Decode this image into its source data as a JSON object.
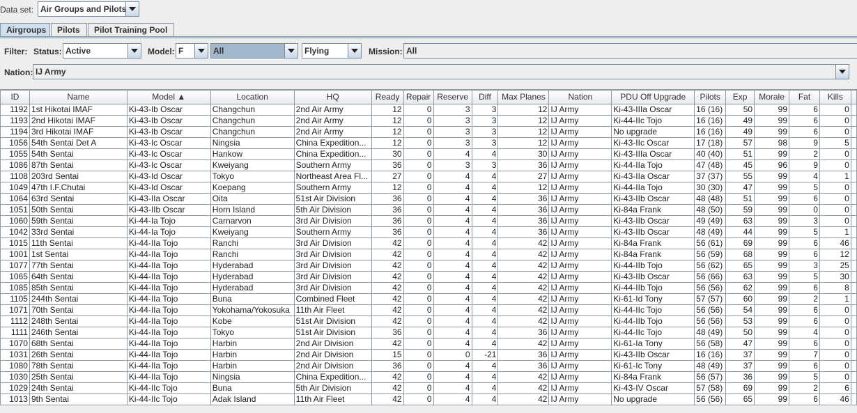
{
  "dataset": {
    "label": "Data set:",
    "value": "Air Groups and Pilots"
  },
  "tabs": [
    "Airgroups",
    "Pilots",
    "Pilot Training Pool"
  ],
  "filter": {
    "label": "Filter:",
    "status_label": "Status:",
    "status": "Active",
    "model_label": "Model:",
    "model": "F",
    "model_type": "All",
    "flying": "Flying",
    "mission_label": "Mission:",
    "mission": "All",
    "nation_label": "Nation:",
    "nation": "IJ Army"
  },
  "columns": [
    {
      "label": "ID",
      "n": 1
    },
    {
      "label": "Name",
      "n": 0
    },
    {
      "label": "Model ▲",
      "n": 0
    },
    {
      "label": "Location",
      "n": 0
    },
    {
      "label": "HQ",
      "n": 0
    },
    {
      "label": "Ready",
      "n": 1
    },
    {
      "label": "Repair",
      "n": 1
    },
    {
      "label": "Reserve",
      "n": 1
    },
    {
      "label": "Diff",
      "n": 1
    },
    {
      "label": "Max Planes",
      "n": 1
    },
    {
      "label": "Nation",
      "n": 0
    },
    {
      "label": "PDU Off Upgrade",
      "n": 0
    },
    {
      "label": "Pilots",
      "n": 0
    },
    {
      "label": "Exp",
      "n": 1
    },
    {
      "label": "Morale",
      "n": 1
    },
    {
      "label": "Fat",
      "n": 1
    },
    {
      "label": "Kills",
      "n": 1
    },
    {
      "label": "",
      "n": 0
    }
  ],
  "rows": [
    [
      "1192",
      "1st Hikotai IMAF",
      "Ki-43-Ib Oscar",
      "Changchun",
      "2nd Air Army",
      "12",
      "0",
      "3",
      "3",
      "12",
      "IJ Army",
      "Ki-43-IIIa Oscar",
      "16 (16)",
      "50",
      "99",
      "6",
      "0",
      ""
    ],
    [
      "1193",
      "2nd Hikotai IMAF",
      "Ki-43-Ib Oscar",
      "Changchun",
      "2nd Air Army",
      "12",
      "0",
      "3",
      "3",
      "12",
      "IJ Army",
      "Ki-44-IIc Tojo",
      "16 (16)",
      "49",
      "99",
      "6",
      "0",
      ""
    ],
    [
      "1194",
      "3rd Hikotai IMAF",
      "Ki-43-Ib Oscar",
      "Changchun",
      "2nd Air Army",
      "12",
      "0",
      "3",
      "3",
      "12",
      "IJ Army",
      "No upgrade",
      "16 (16)",
      "49",
      "99",
      "6",
      "0",
      ""
    ],
    [
      "1056",
      "54th Sentai Det A",
      "Ki-43-Ic Oscar",
      "Ningsia",
      "China Expedition...",
      "12",
      "0",
      "3",
      "3",
      "12",
      "IJ Army",
      "Ki-43-IIc Oscar",
      "17 (18)",
      "57",
      "98",
      "9",
      "5",
      ""
    ],
    [
      "1055",
      "54th Sentai",
      "Ki-43-Ic Oscar",
      "Hankow",
      "China Expedition...",
      "30",
      "0",
      "4",
      "4",
      "30",
      "IJ Army",
      "Ki-43-IIIa Oscar",
      "40 (40)",
      "51",
      "99",
      "2",
      "0",
      ""
    ],
    [
      "1086",
      "87th Sentai",
      "Ki-43-Ic Oscar",
      "Kweiyang",
      "Southern Army",
      "36",
      "0",
      "3",
      "3",
      "36",
      "IJ Army",
      "Ki-44-IIa Tojo",
      "47 (48)",
      "45",
      "96",
      "9",
      "0",
      ""
    ],
    [
      "1108",
      "203rd Sentai",
      "Ki-43-Id Oscar",
      "Tokyo",
      "Northeast Area Fl...",
      "27",
      "0",
      "4",
      "4",
      "27",
      "IJ Army",
      "Ki-43-IIa Oscar",
      "37 (37)",
      "55",
      "99",
      "4",
      "1",
      ""
    ],
    [
      "1049",
      "47th I.F.Chutai",
      "Ki-43-Id Oscar",
      "Koepang",
      "Southern Army",
      "12",
      "0",
      "4",
      "4",
      "12",
      "IJ Army",
      "Ki-44-IIa Tojo",
      "30 (30)",
      "47",
      "99",
      "5",
      "0",
      ""
    ],
    [
      "1064",
      "63rd Sentai",
      "Ki-43-IIa Oscar",
      "Oita",
      "51st Air Division",
      "36",
      "0",
      "4",
      "4",
      "36",
      "IJ Army",
      "Ki-43-IIb Oscar",
      "48 (48)",
      "51",
      "99",
      "6",
      "0",
      ""
    ],
    [
      "1051",
      "50th Sentai",
      "Ki-43-IIb Oscar",
      "Horn Island",
      "5th Air Division",
      "36",
      "0",
      "4",
      "4",
      "36",
      "IJ Army",
      "Ki-84a Frank",
      "48 (50)",
      "59",
      "99",
      "0",
      "0",
      ""
    ],
    [
      "1060",
      "59th Sentai",
      "Ki-44-Ia Tojo",
      "Carnarvon",
      "3rd Air Division",
      "36",
      "0",
      "4",
      "4",
      "36",
      "IJ Army",
      "Ki-43-IIb Oscar",
      "49 (49)",
      "63",
      "99",
      "3",
      "0",
      ""
    ],
    [
      "1042",
      "33rd Sentai",
      "Ki-44-Ia Tojo",
      "Kweiyang",
      "Southern Army",
      "36",
      "0",
      "4",
      "4",
      "36",
      "IJ Army",
      "Ki-43-IIb Oscar",
      "48 (49)",
      "44",
      "99",
      "5",
      "1",
      ""
    ],
    [
      "1015",
      "11th Sentai",
      "Ki-44-IIa Tojo",
      "Ranchi",
      "3rd Air Division",
      "42",
      "0",
      "4",
      "4",
      "42",
      "IJ Army",
      "Ki-84a Frank",
      "56 (61)",
      "69",
      "99",
      "6",
      "46",
      ""
    ],
    [
      "1001",
      "1st Sentai",
      "Ki-44-IIa Tojo",
      "Ranchi",
      "3rd Air Division",
      "42",
      "0",
      "4",
      "4",
      "42",
      "IJ Army",
      "Ki-84a Frank",
      "56 (59)",
      "68",
      "99",
      "6",
      "12",
      ""
    ],
    [
      "1077",
      "77th Sentai",
      "Ki-44-IIa Tojo",
      "Hyderabad",
      "3rd Air Division",
      "42",
      "0",
      "4",
      "4",
      "42",
      "IJ Army",
      "Ki-44-IIb Tojo",
      "56 (62)",
      "65",
      "99",
      "3",
      "25",
      ""
    ],
    [
      "1065",
      "64th Sentai",
      "Ki-44-IIa Tojo",
      "Hyderabad",
      "3rd Air Division",
      "42",
      "0",
      "4",
      "4",
      "42",
      "IJ Army",
      "Ki-43-IIb Oscar",
      "56 (66)",
      "63",
      "99",
      "5",
      "30",
      ""
    ],
    [
      "1085",
      "85th Sentai",
      "Ki-44-IIa Tojo",
      "Hyderabad",
      "3rd Air Division",
      "42",
      "0",
      "4",
      "4",
      "42",
      "IJ Army",
      "Ki-44-IIb Tojo",
      "56 (56)",
      "62",
      "99",
      "6",
      "8",
      ""
    ],
    [
      "1105",
      "244th Sentai",
      "Ki-44-IIa Tojo",
      "Buna",
      "Combined Fleet",
      "42",
      "0",
      "4",
      "4",
      "42",
      "IJ Army",
      "Ki-61-Id Tony",
      "57 (57)",
      "60",
      "99",
      "2",
      "1",
      ""
    ],
    [
      "1071",
      "70th Sentai",
      "Ki-44-IIa Tojo",
      "Yokohama/Yokosuka",
      "11th Air Fleet",
      "42",
      "0",
      "4",
      "4",
      "42",
      "IJ Army",
      "Ki-44-IIc Tojo",
      "56 (56)",
      "54",
      "99",
      "6",
      "0",
      ""
    ],
    [
      "1112",
      "248th Sentai",
      "Ki-44-IIa Tojo",
      "Kobe",
      "51st Air Division",
      "42",
      "0",
      "4",
      "4",
      "42",
      "IJ Army",
      "Ki-44-IIb Tojo",
      "56 (56)",
      "53",
      "99",
      "6",
      "0",
      ""
    ],
    [
      "1111",
      "246th Sentai",
      "Ki-44-IIa Tojo",
      "Tokyo",
      "51st Air Division",
      "36",
      "0",
      "4",
      "4",
      "36",
      "IJ Army",
      "Ki-44-IIc Tojo",
      "48 (49)",
      "50",
      "99",
      "4",
      "0",
      ""
    ],
    [
      "1070",
      "68th Sentai",
      "Ki-44-IIa Tojo",
      "Harbin",
      "2nd Air Division",
      "42",
      "0",
      "4",
      "4",
      "42",
      "IJ Army",
      "Ki-61-Ia Tony",
      "56 (58)",
      "47",
      "99",
      "6",
      "0",
      ""
    ],
    [
      "1031",
      "26th Sentai",
      "Ki-44-IIa Tojo",
      "Harbin",
      "2nd Air Division",
      "15",
      "0",
      "0",
      "-21",
      "36",
      "IJ Army",
      "Ki-43-IIb Oscar",
      "16 (16)",
      "37",
      "99",
      "7",
      "0",
      ""
    ],
    [
      "1080",
      "78th Sentai",
      "Ki-44-IIa Tojo",
      "Harbin",
      "2nd Air Division",
      "36",
      "0",
      "4",
      "4",
      "36",
      "IJ Army",
      "Ki-61-Ic Tony",
      "48 (49)",
      "37",
      "99",
      "6",
      "0",
      ""
    ],
    [
      "1030",
      "25th Sentai",
      "Ki-44-IIa Tojo",
      "Ningsia",
      "China Expedition...",
      "42",
      "0",
      "4",
      "4",
      "42",
      "IJ Army",
      "Ki-84a Frank",
      "56 (57)",
      "36",
      "99",
      "5",
      "0",
      ""
    ],
    [
      "1029",
      "24th Sentai",
      "Ki-44-IIc Tojo",
      "Buna",
      "5th Air Division",
      "42",
      "0",
      "4",
      "4",
      "42",
      "IJ Army",
      "Ki-43-IV Oscar",
      "57 (58)",
      "69",
      "99",
      "2",
      "6",
      ""
    ],
    [
      "1013",
      "9th Sentai",
      "Ki-44-IIc Tojo",
      "Adak Island",
      "11th Air Fleet",
      "42",
      "0",
      "4",
      "4",
      "42",
      "IJ Army",
      "No upgrade",
      "56 (56)",
      "65",
      "99",
      "6",
      "46",
      ""
    ]
  ]
}
